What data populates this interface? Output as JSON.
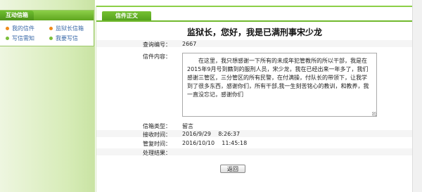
{
  "sidebar": {
    "title": "互动信箱",
    "items": [
      {
        "label": "我的信件"
      },
      {
        "label": "监狱长信箱"
      },
      {
        "label": "写信需知"
      },
      {
        "label": "我要写信"
      }
    ]
  },
  "main": {
    "tab": "信件正文",
    "letter_title": "监狱长，您好，我是已满刑事宋少龙",
    "fields": {
      "query_no_label": "查询编号：",
      "query_no": "2667",
      "content_label": "信件内容：",
      "content": "在这里，我只想感谢一下所有的未成年犯管教所的所以干部，我是在2015年9月号到籍到的服刑人员，宋少龙，我在已经出来一年多了，我们感谢三管区，三分管区的所有民警，在付满操，付队长的带领下，让我学到了很多东西，感谢你们，所有干部,我一生刻苦铭心的教训，和教养，我一直没忘记，感谢你们",
      "type_label": "信箱类型：",
      "type": "留言",
      "receive_label": "接收时间：",
      "receive": "2016/9/29    8:26:37",
      "manage_label": "管复时间：",
      "manage": "2016/10/10    11:45:18",
      "result_label": "处理结果："
    },
    "back_label": "返回"
  }
}
